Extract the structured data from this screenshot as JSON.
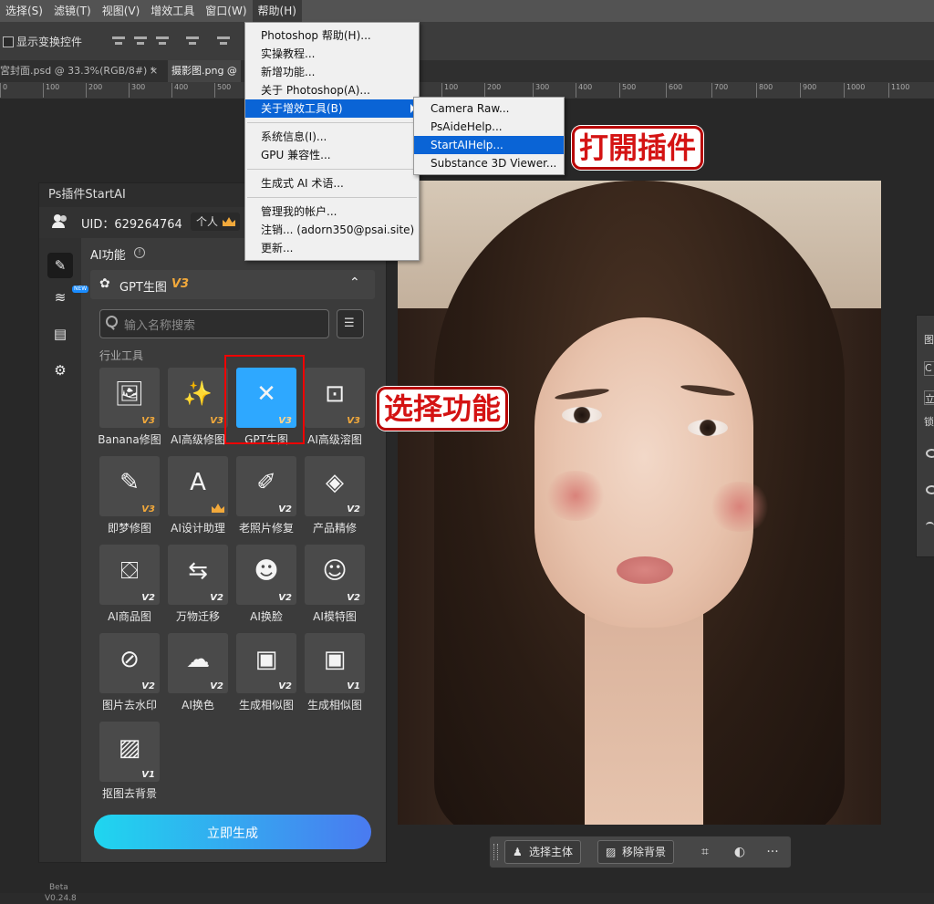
{
  "menubar": [
    "选择(S)",
    "滤镜(T)",
    "视图(V)",
    "增效工具",
    "窗口(W)",
    "帮助(H)"
  ],
  "options": {
    "show_transform": "显示变换控件"
  },
  "tabs": [
    {
      "label": "宮封面.psd @ 33.3%(RGB/8#) *"
    },
    {
      "label": "×"
    },
    {
      "label": "摄影图.png @"
    }
  ],
  "ruler_ticks": [
    "100",
    "200",
    "300",
    "400",
    "500",
    "600",
    "700",
    "800",
    "900",
    "1000",
    "1100"
  ],
  "help_menu": {
    "items": [
      "Photoshop 帮助(H)...",
      "实操教程...",
      "新增功能...",
      "关于 Photoshop(A)...",
      "关于增效工具(B)",
      "系统信息(I)...",
      "GPU 兼容性...",
      "生成式 AI 术语...",
      "管理我的帐户...",
      "注销... (adorn350@psai.site)",
      "更新..."
    ]
  },
  "sub_menu": {
    "items": [
      "Camera Raw...",
      "PsAideHelp...",
      "StartAIHelp...",
      "Substance 3D Viewer..."
    ]
  },
  "annotations": {
    "open_plugin": "打開插件",
    "select_feature": "选择功能"
  },
  "panel": {
    "title": "Ps插件StartAI",
    "uid_label": "UID：629264764",
    "plan": "个人",
    "ai_func": "AI功能",
    "new_badge": "NEW",
    "section_title": "GPT生图",
    "section_version": "V3",
    "search_placeholder": "输入名称搜索",
    "industry_tools": "行业工具",
    "beta": "Beta",
    "version": "V0.24.8",
    "generate": "立即生成",
    "tiles": [
      {
        "label": "Banana修图",
        "ver": "V3",
        "icon": "🖼"
      },
      {
        "label": "AI高级修图",
        "ver": "V3",
        "icon": "✨"
      },
      {
        "label": "GPT生图",
        "ver": "V3",
        "icon": "✕"
      },
      {
        "label": "AI高级溶图",
        "ver": "V3",
        "icon": "⊡"
      },
      {
        "label": "即梦修图",
        "ver": "V3",
        "icon": "✎"
      },
      {
        "label": "AI设计助理",
        "ver": "",
        "icon": "A"
      },
      {
        "label": "老照片修复",
        "ver": "V2",
        "icon": "✐"
      },
      {
        "label": "产品精修",
        "ver": "V2",
        "icon": "◈"
      },
      {
        "label": "AI商品图",
        "ver": "V2",
        "icon": "⛋"
      },
      {
        "label": "万物迁移",
        "ver": "V2",
        "icon": "⇆"
      },
      {
        "label": "AI换脸",
        "ver": "V2",
        "icon": "☻"
      },
      {
        "label": "AI模特图",
        "ver": "V2",
        "icon": "☺"
      },
      {
        "label": "图片去水印",
        "ver": "V2",
        "icon": "⊘"
      },
      {
        "label": "AI换色",
        "ver": "V2",
        "icon": "☁"
      },
      {
        "label": "生成相似图",
        "ver": "V2",
        "icon": "▣"
      },
      {
        "label": "生成相似图",
        "ver": "V1",
        "icon": "▣"
      },
      {
        "label": "抠图去背景",
        "ver": "V1",
        "icon": "▨"
      }
    ]
  },
  "ctxbar": {
    "select_subject": "选择主体",
    "remove_bg": "移除背景",
    "more": "···"
  },
  "right_panel": {
    "letter1": "图",
    "letter2": "C",
    "letter3": "立",
    "letter4": "锁"
  }
}
